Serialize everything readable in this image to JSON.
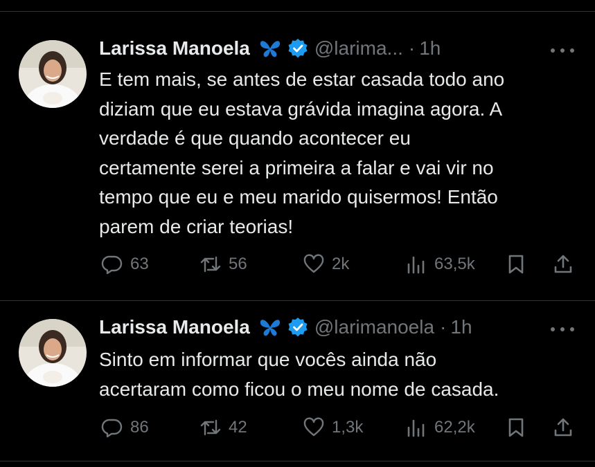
{
  "tweets": [
    {
      "author_name": "Larissa Manoela",
      "handle": "@larima...",
      "dot": "·",
      "time": "1h",
      "text": "E tem mais, se antes de estar casada todo ano\ndiziam que eu estava grávida imagina agora. A\nverdade é que quando acontecer eu\ncertamente serei a primeira a falar e vai vir no\ntempo que eu e meu marido quisermos! Então\nparem de criar teorias!",
      "replies": "63",
      "reposts": "56",
      "likes": "2k",
      "views": "63,5k"
    },
    {
      "author_name": "Larissa Manoela",
      "handle": "@larimanoela",
      "dot": "·",
      "time": "1h",
      "text": "Sinto em informar que vocês ainda não\nacertaram como ficou o meu nome de casada.",
      "replies": "86",
      "reposts": "42",
      "likes": "1,3k",
      "views": "62,2k"
    }
  ],
  "icons": {
    "badge": "butterfly-icon",
    "verified": "verified-badge-icon",
    "more": "more-options-icon",
    "reply": "reply-icon",
    "repost": "repost-icon",
    "like": "like-icon",
    "views": "views-icon",
    "bookmark": "bookmark-icon",
    "share": "share-icon"
  },
  "colors": {
    "background": "#000000",
    "text": "#e7e9ea",
    "muted": "#71767b",
    "verified": "#1d9bf0",
    "butterfly": "#1d7bd6",
    "divider": "#2f3336"
  }
}
